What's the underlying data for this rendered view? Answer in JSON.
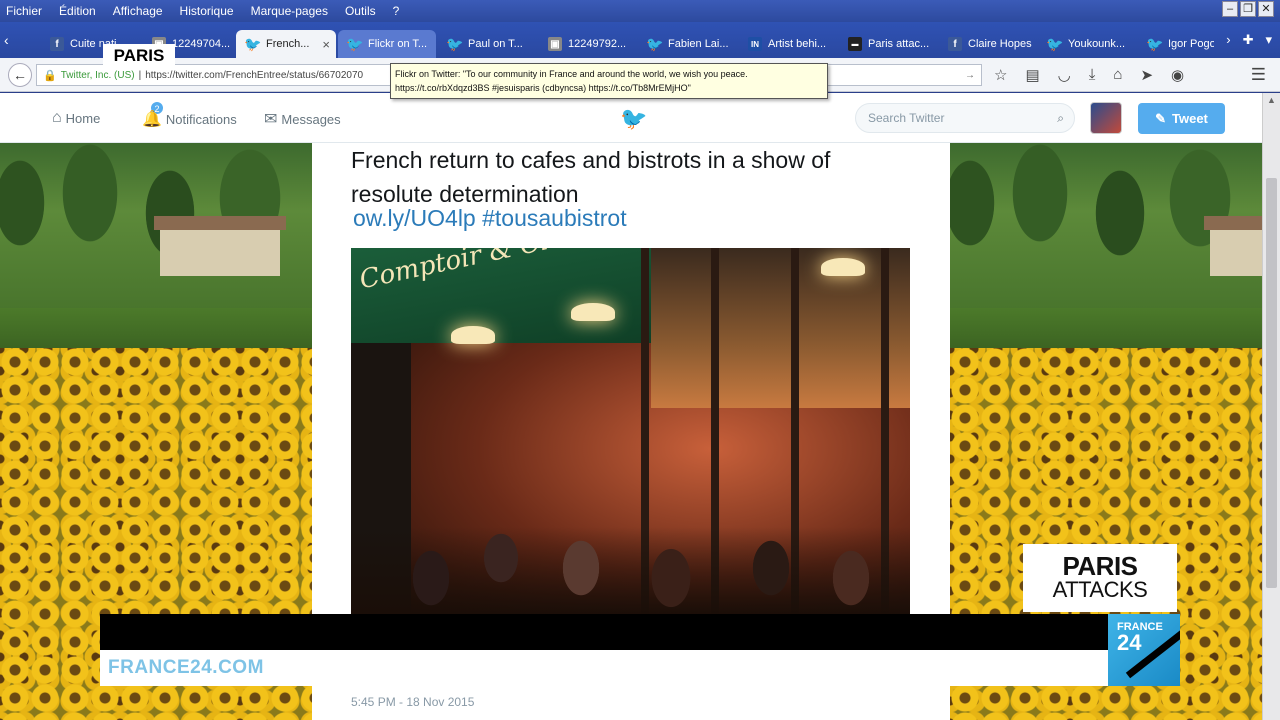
{
  "menubar": {
    "items": [
      "Fichier",
      "Édition",
      "Affichage",
      "Historique",
      "Marque-pages",
      "Outils",
      "?"
    ]
  },
  "tabs": [
    {
      "icon": "facebook-icon",
      "label": "Cuite nati..."
    },
    {
      "icon": "image-icon",
      "label": "12249704..."
    },
    {
      "icon": "twitter-icon",
      "label": "French..."
    },
    {
      "icon": "twitter-icon",
      "label": "Flickr on T..."
    },
    {
      "icon": "twitter-icon",
      "label": "Paul on T..."
    },
    {
      "icon": "image-icon",
      "label": "12249792..."
    },
    {
      "icon": "twitter-icon",
      "label": "Fabien Lai..."
    },
    {
      "icon": "in-icon",
      "label": "Artist behi..."
    },
    {
      "icon": "news-icon",
      "label": "Paris attac..."
    },
    {
      "icon": "facebook-icon",
      "label": "Claire Hopes"
    },
    {
      "icon": "twitter-icon",
      "label": "Youkounk..."
    },
    {
      "icon": "twitter-icon",
      "label": "Igor Pogo..."
    }
  ],
  "urlbar": {
    "org": "Twitter, Inc. (US)",
    "url": "https://twitter.com/FrenchEntree/status/66702070"
  },
  "tooltip": {
    "line1": "Flickr on Twitter: \"To our community in France and around the world, we wish you peace.",
    "line2": "https://t.co/rbXdqzd3BS #jesuisparis (cdbyncsa) https://t.co/Tb8MrEMjHO\""
  },
  "twitter": {
    "nav_home": "Home",
    "nav_notifications": "Notifications",
    "notifications_count": "2",
    "nav_messages": "Messages",
    "search_placeholder": "Search Twitter",
    "tweet_button": "Tweet"
  },
  "tweet": {
    "text": "French return to cafes and bistrots in a show of resolute determination",
    "link": "ow.ly/UO4lp",
    "hashtag": "#tousaubistrot",
    "photo_sign": "Comptoir & Cie...",
    "timestamp": "5:45 PM - 18 Nov 2015"
  },
  "overlay": {
    "paris_tag": "PARIS",
    "ticker_site": "FRANCE24.COM",
    "attacks_line1": "PARIS",
    "attacks_line2": "ATTACKS",
    "logo_line1": "FRANCE",
    "logo_line2": "24"
  },
  "colors": {
    "twitter_blue": "#55acee",
    "link_blue": "#2b7bb9",
    "france24_blue": "#3fb4e8"
  }
}
